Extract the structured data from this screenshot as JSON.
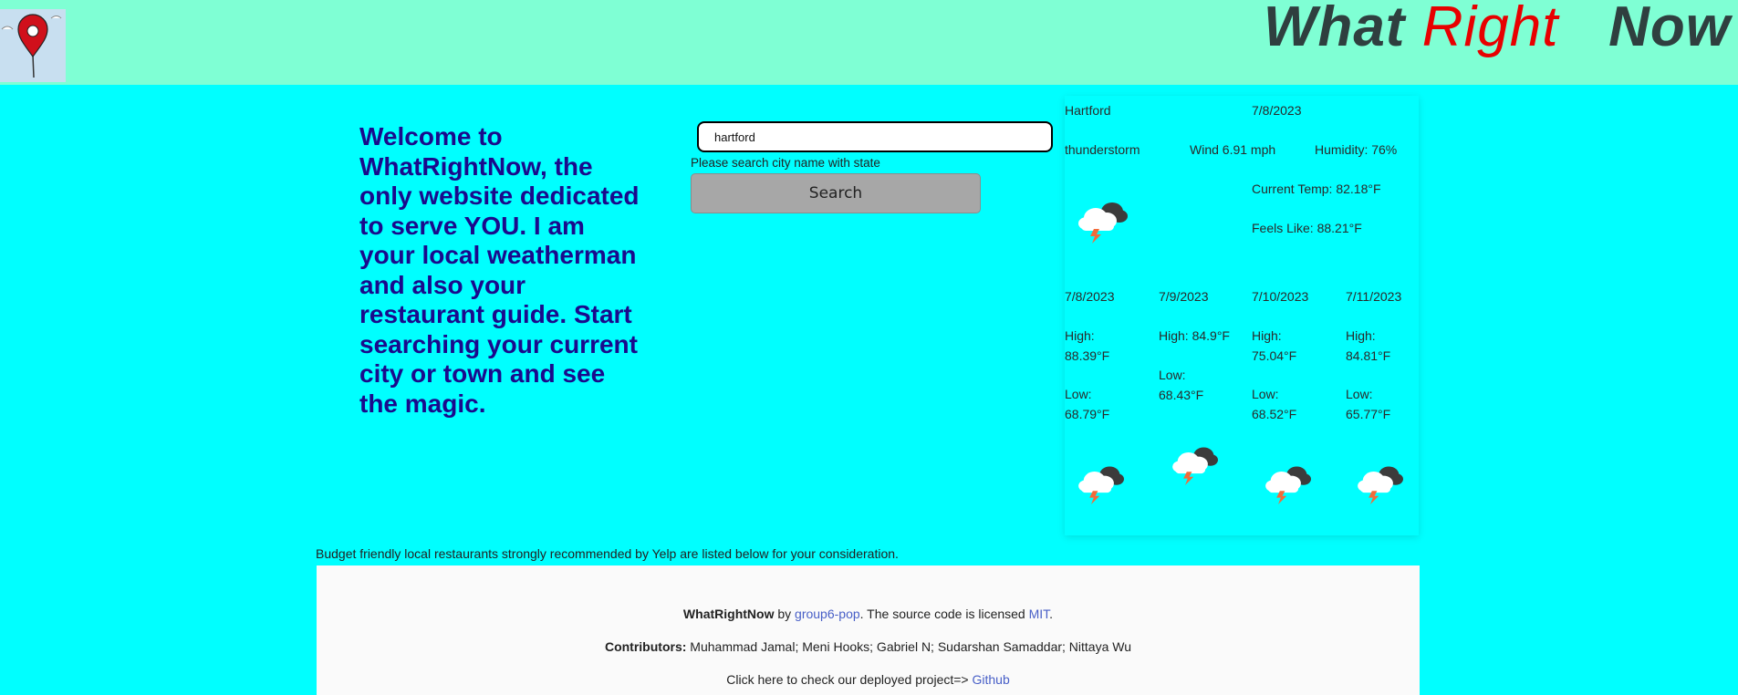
{
  "header": {
    "title_what": "What",
    "title_right": "Right",
    "title_now": "Now",
    "logo_icon": "map-pin-icon"
  },
  "welcome": {
    "text": "Welcome to WhatRightNow, the only website dedicated to serve YOU. I am your local weatherman and also your restaurant guide. Start searching your current city or town and see the magic."
  },
  "search": {
    "value": "hartford",
    "hint": "Please search city name with state",
    "button_label": "Search"
  },
  "weather": {
    "city": "Hartford",
    "date": "7/8/2023",
    "condition": "thunderstorm",
    "wind": "Wind 6.91 mph",
    "humidity": "Humidity: 76%",
    "current_temp": "Current Temp: 82.18°F",
    "feels_like": "Feels Like: 88.21°F",
    "icon": "thunderstorm-cloud-icon",
    "forecast": [
      {
        "date": "7/8/2023",
        "high": "High: 88.39°F",
        "low": "Low: 68.79°F"
      },
      {
        "date": "7/9/2023",
        "high": "High: 84.9°F",
        "low": "Low: 68.43°F"
      },
      {
        "date": "7/10/2023",
        "high": "High: 75.04°F",
        "low": "Low: 68.52°F"
      },
      {
        "date": "7/11/2023",
        "high": "High: 84.81°F",
        "low": "Low: 65.77°F"
      }
    ]
  },
  "restaurants_caption": "Budget friendly local restaurants strongly recommended by Yelp are listed below for your consideration.",
  "footer": {
    "brand": "WhatRightNow",
    "by": " by ",
    "author_link": "group6-pop",
    "license_text": ". The source code is licensed ",
    "license_link": "MIT",
    "license_end": ".",
    "contributors_label": "Contributors:",
    "contributors": " Muhammad Jamal; Meni Hooks; Gabriel N; Sudarshan Samaddar; Nittaya Wu",
    "deploy_text": "Click here to check our deployed project=> ",
    "github_link": "Github"
  }
}
